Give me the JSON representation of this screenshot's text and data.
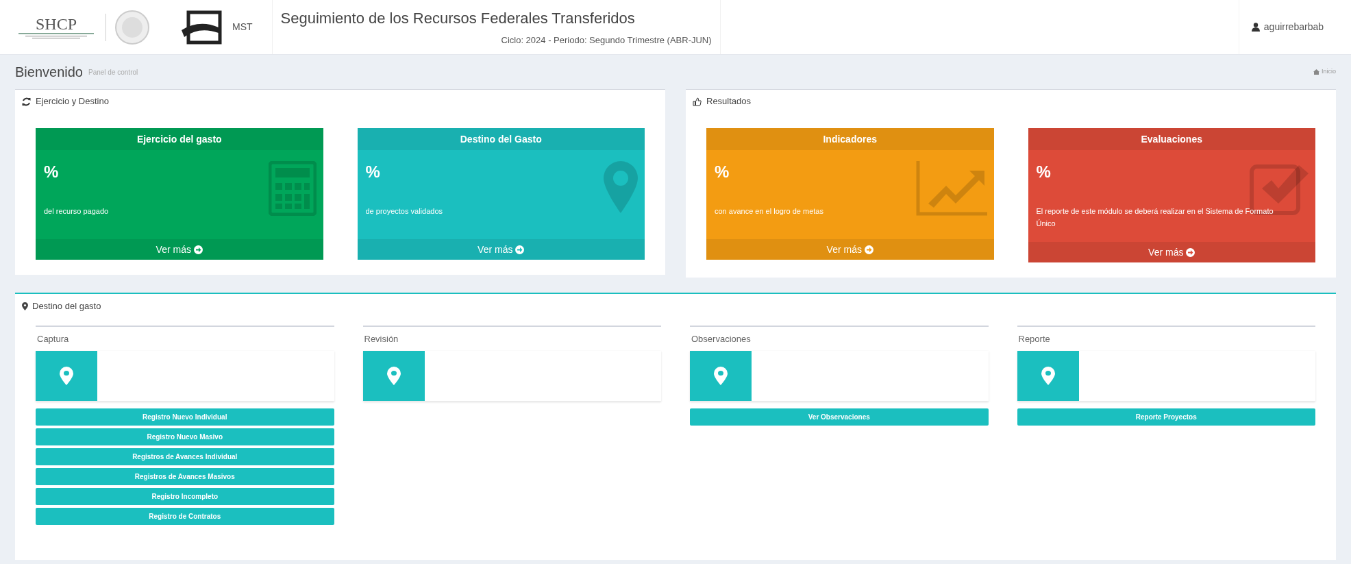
{
  "header": {
    "logo_text": "SHCP",
    "brand_text": "MST",
    "title": "Seguimiento de los Recursos Federales Transferidos",
    "subtitle": "Ciclo: 2024 - Periodo: Segundo Trimestre (ABR-JUN)",
    "user": "aguirrebarbab"
  },
  "page": {
    "title": "Bienvenido",
    "subtitle": "Panel de control",
    "breadcrumb": "Inicio"
  },
  "panels": [
    {
      "title": "Ejercicio y Destino",
      "kind": "refresh",
      "cards": [
        {
          "title": "Ejercicio del gasto",
          "value": "%",
          "description": "del recurso pagado",
          "link": "Ver más",
          "color": "#00a65a",
          "kind": "calculator"
        },
        {
          "title": "Destino del Gasto",
          "value": "%",
          "description": "de proyectos validados",
          "link": "Ver más",
          "color": "#1bbfbf",
          "kind": "marker"
        }
      ]
    },
    {
      "title": "Resultados",
      "kind": "thumb",
      "cards": [
        {
          "title": "Indicadores",
          "value": "%",
          "description": "con avance en el logro de metas",
          "link": "Ver más",
          "color": "#f39c12",
          "kind": "chart"
        },
        {
          "title": "Evaluaciones",
          "value": "%",
          "description": "El reporte de este módulo se deberá realizar en el Sistema de Formato Único",
          "link": "Ver más",
          "color": "#dd4b39",
          "kind": "check"
        }
      ]
    }
  ],
  "destino": {
    "title": "Destino del gasto",
    "columns": [
      {
        "title": "Captura",
        "buttons": [
          "Registro Nuevo Individual",
          "Registro Nuevo Masivo",
          "Registros de Avances Individual",
          "Registros de Avances Masivos",
          "Registro Incompleto",
          "Registro de Contratos"
        ]
      },
      {
        "title": "Revisión"
      },
      {
        "title": "Observaciones",
        "buttons": [
          "Ver Observaciones"
        ]
      },
      {
        "title": "Reporte",
        "buttons": [
          "Reporte Proyectos"
        ]
      }
    ]
  }
}
